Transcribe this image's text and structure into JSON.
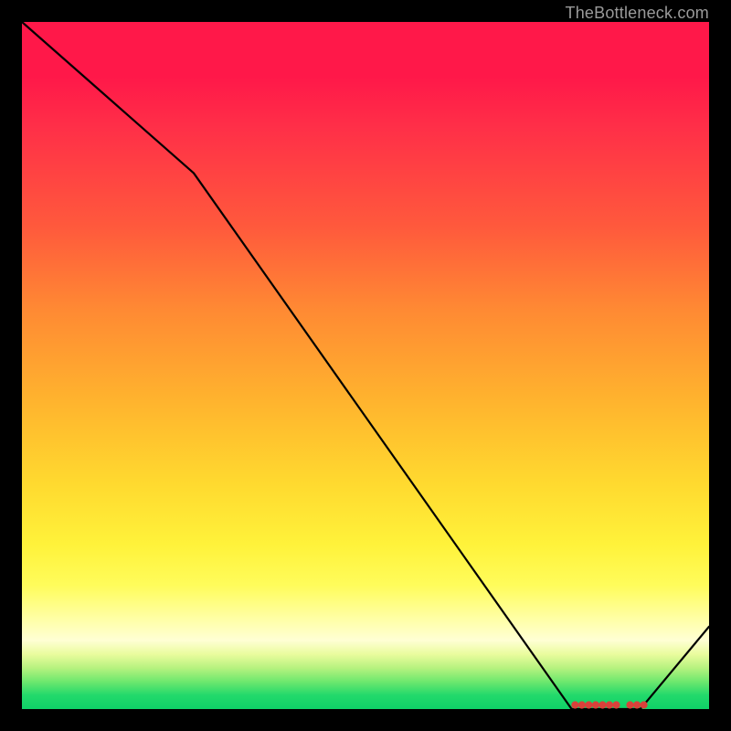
{
  "attribution": "TheBottleneck.com",
  "chart_data": {
    "type": "line",
    "title": "",
    "xlabel": "",
    "ylabel": "",
    "xlim": [
      0,
      100
    ],
    "ylim": [
      0,
      100
    ],
    "x": [
      0,
      25,
      80,
      90,
      100
    ],
    "values": [
      100,
      78,
      0,
      0,
      12
    ],
    "markers": {
      "x": [
        80.5,
        81.5,
        82.5,
        83.5,
        84.5,
        85.5,
        86.5,
        88.5,
        89.5,
        90.5
      ],
      "y": [
        0.6,
        0.6,
        0.6,
        0.6,
        0.6,
        0.6,
        0.6,
        0.6,
        0.6,
        0.6
      ]
    },
    "background": "rainbow-vertical-gradient",
    "grid": false,
    "legend": false
  }
}
